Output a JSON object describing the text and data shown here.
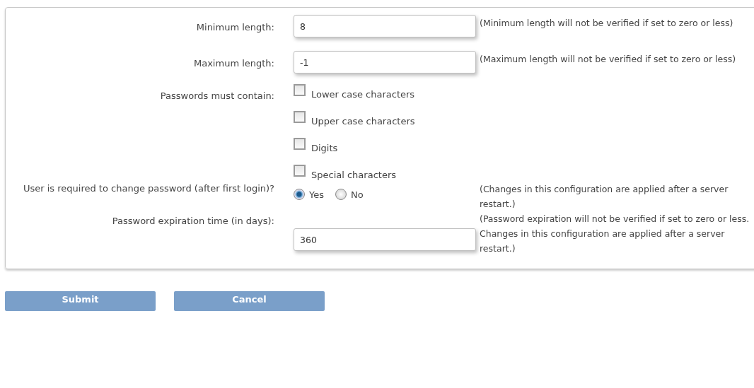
{
  "fields": [
    {
      "kind": "text",
      "label": "Minimum length:",
      "value": "8",
      "note": "(Minimum length will not be verified if set to zero or less)"
    },
    {
      "kind": "text",
      "label": "Maximum length:",
      "value": "-1",
      "note": "(Maximum length will not be verified if set to zero or less)"
    },
    {
      "kind": "checkboxes",
      "label": "Passwords must contain:",
      "options": [
        {
          "label": "Lower case characters",
          "checked": false
        },
        {
          "label": "Upper case characters",
          "checked": false
        },
        {
          "label": "Digits",
          "checked": false
        },
        {
          "label": "Special characters",
          "checked": false
        }
      ]
    },
    {
      "kind": "radios",
      "label": "User is required to change password (after first login)?",
      "options": [
        {
          "label": "Yes",
          "selected": true
        },
        {
          "label": "No",
          "selected": false
        }
      ],
      "note": "(Changes in this configuration are applied after a server restart.)"
    },
    {
      "kind": "text",
      "label": "Password expiration time (in days):",
      "value": "360",
      "note": "(Password expiration will not be verified if set to zero or less. Changes in this configuration are applied after a server restart.)"
    }
  ],
  "buttons": [
    "Submit",
    "Cancel"
  ]
}
